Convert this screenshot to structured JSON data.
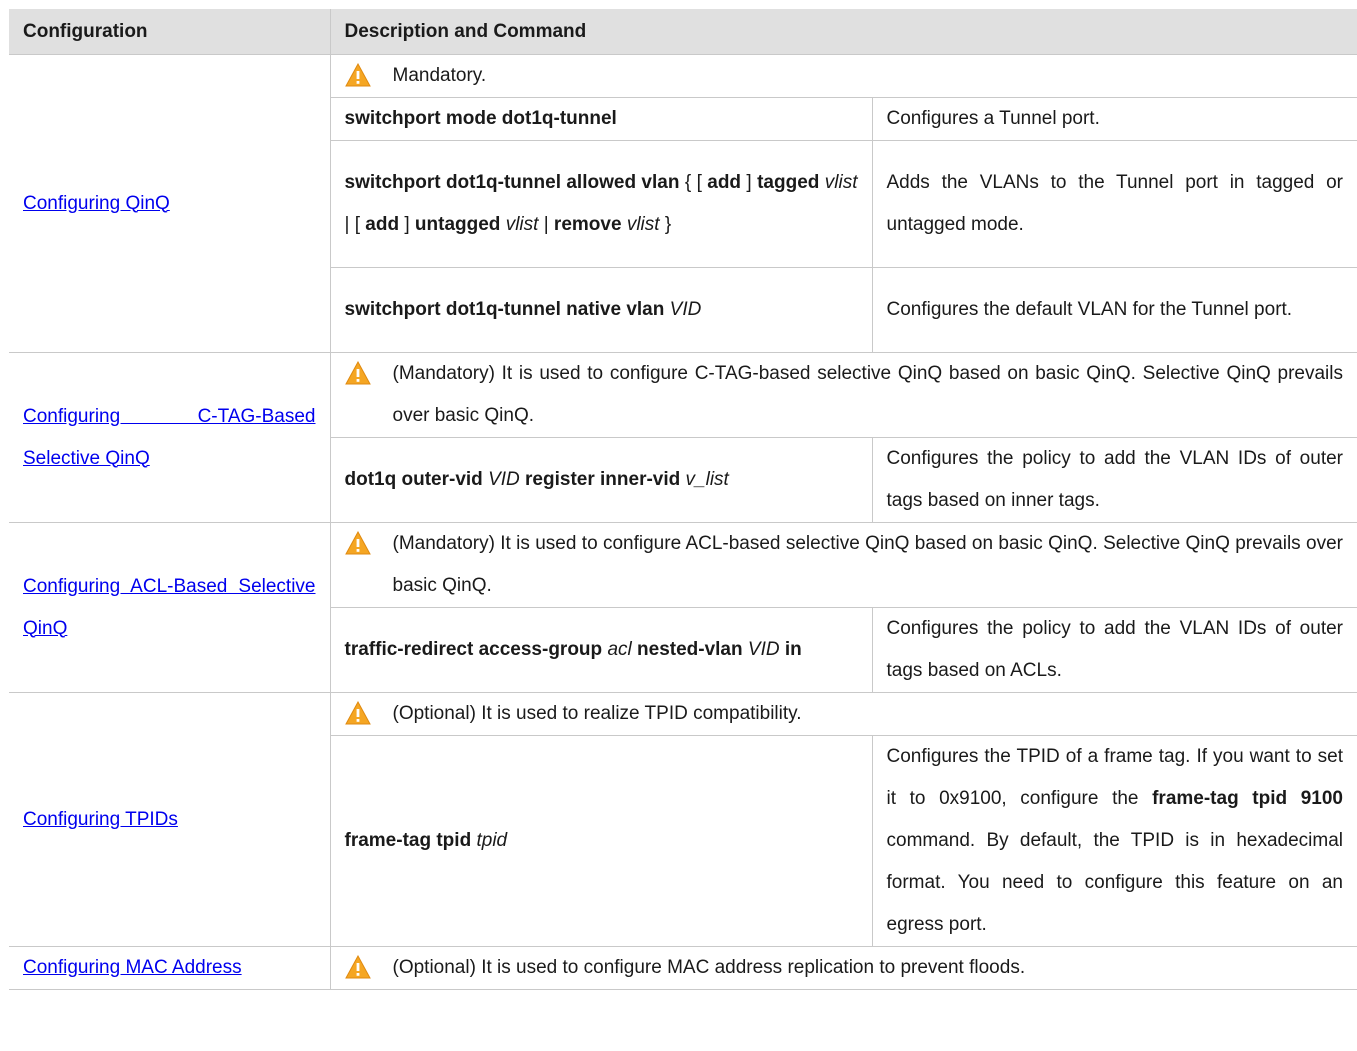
{
  "header": {
    "configuration": "Configuration",
    "description": "Description and Command"
  },
  "sections": {
    "qinq": {
      "link": "Configuring QinQ",
      "note": "Mandatory.",
      "cmd1": {
        "parts": [
          "switchport mode dot1q-tunnel"
        ],
        "desc": "Configures a Tunnel port."
      },
      "cmd2": {
        "p1": "switchport dot1q-tunnel allowed vlan",
        "p2": " { [ ",
        "p3": "add",
        "p4": " ]",
        "p5": "tagged",
        "p6": "vlist",
        "p7": " | [ ",
        "p8": "add",
        "p9": " ] ",
        "p10": "untagged",
        "p11": "vlist",
        "p12": " | ",
        "p13": "remove",
        "p14": "vlist",
        "p15": " }",
        "desc": "Adds the VLANs to the Tunnel port in tagged or untagged mode."
      },
      "cmd3": {
        "p1": "switchport dot1q-tunnel native vlan",
        "p2": "VID",
        "desc": "Configures the default VLAN for the Tunnel port."
      }
    },
    "ctag": {
      "link": "Configuring C-TAG-Based Selective QinQ",
      "note": "(Mandatory) It is used to configure C-TAG-based selective QinQ based on basic QinQ. Selective QinQ prevails over basic QinQ.",
      "cmd": {
        "p1": "dot1q outer-vid",
        "p2": "VID",
        "p3": "register inner-vid",
        "p4": "v_list",
        "desc": "Configures the policy to add the VLAN IDs of outer tags based on inner tags."
      }
    },
    "acl": {
      "link": "Configuring ACL-Based Selective QinQ",
      "note": "(Mandatory) It is used to configure ACL-based selective QinQ based on basic QinQ. Selective QinQ prevails over basic QinQ.",
      "cmd": {
        "p1": "traffic-redirect access-group",
        "p2": "acl",
        "p3": "nested-vlan",
        "p4": "VID",
        "p5": "in",
        "desc": "Configures the policy to add the VLAN IDs of outer tags based on ACLs."
      }
    },
    "tpid": {
      "link": "Configuring TPIDs",
      "note": "(Optional) It is used to realize TPID compatibility.",
      "cmd": {
        "p1": "frame-tag tpid",
        "p2": "tpid",
        "desc1": "Configures the TPID of a frame tag. If you want to set it to 0x9100, configure the ",
        "desc2": "frame-tag tpid 9100",
        "desc3": " command. By default, the TPID is in hexadecimal format. You need to configure this feature on an egress port."
      }
    },
    "mac": {
      "link": "Configuring MAC Address",
      "note": "(Optional) It is used to configure MAC address replication to prevent floods."
    }
  },
  "colors": {
    "header_bg": "#e0e0e0",
    "link": "#0000ee",
    "warning": "#f5a623"
  },
  "icons": {
    "note": "warning-triangle-icon"
  }
}
